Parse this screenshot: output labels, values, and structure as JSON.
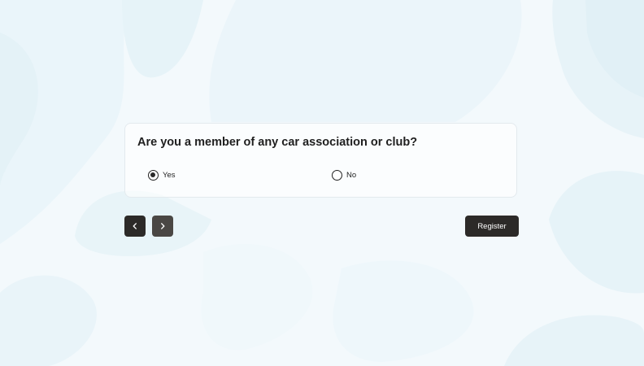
{
  "question": {
    "text": "Are you a member of any car association or club?",
    "options": [
      {
        "label": "Yes",
        "selected": true
      },
      {
        "label": "No",
        "selected": false
      }
    ]
  },
  "navigation": {
    "previous_icon": "chevron-left-icon",
    "next_icon": "chevron-right-icon",
    "register_label": "Register"
  },
  "colors": {
    "background": "#f3f9fc",
    "button_dark": "#2c2a28",
    "button_next": "#4a4744",
    "text": "#1f1f1f"
  }
}
